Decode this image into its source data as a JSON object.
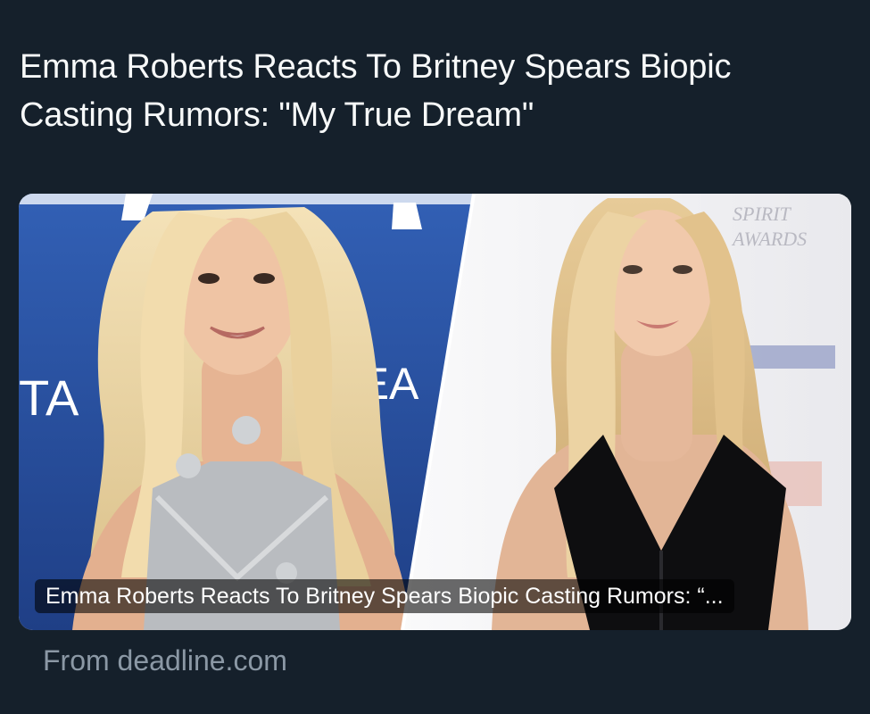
{
  "post": {
    "headline": "Emma Roberts Reacts To Britney Spears Biopic Casting Rumors: \"My True Dream\"",
    "card": {
      "caption": "Emma Roberts Reacts To Britney Spears Biopic Casting Rumors: “...",
      "left_photo_backdrop_text": "TA",
      "left_photo_backdrop_text_right": "ILEA",
      "right_photo_backdrop_text_1": "SPIRIT",
      "right_photo_backdrop_text_2": "AWARDS"
    },
    "source": "From deadline.com"
  },
  "colors": {
    "background": "#15202b",
    "headline_text": "#f7f9f9",
    "secondary_text": "#8b98a5",
    "left_backdrop": "#2b4f9e",
    "right_backdrop": "#f0f0f2"
  }
}
